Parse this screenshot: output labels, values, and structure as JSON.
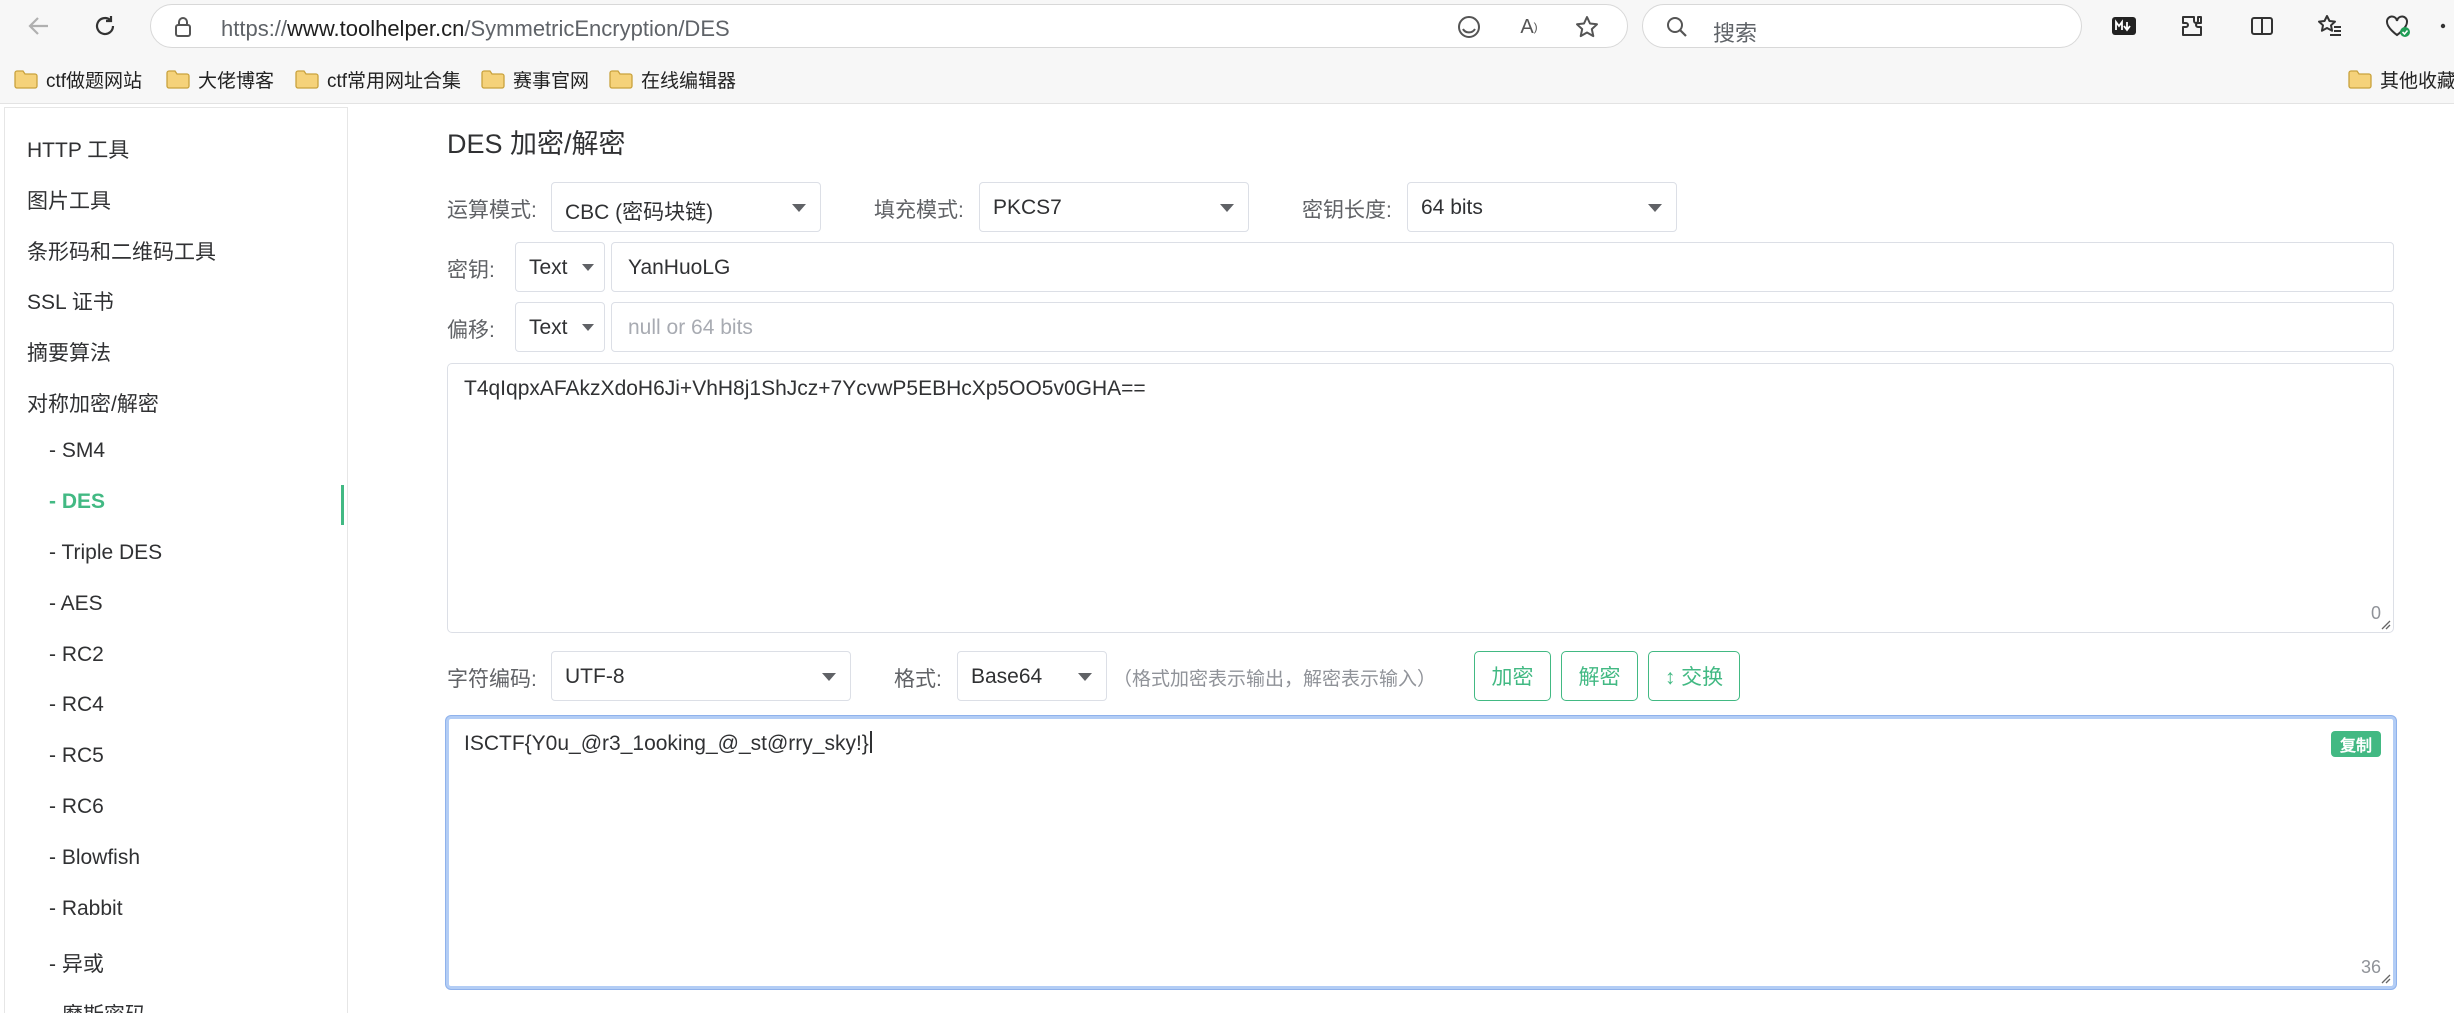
{
  "browser": {
    "url_prefix": "https://",
    "url_domain": "www.toolhelper.cn",
    "url_path": "/SymmetricEncryption/DES",
    "search_placeholder": "搜索",
    "bookmarks": [
      "ctf做题网站",
      "大佬博客",
      "ctf常用网址合集",
      "赛事官网",
      "在线编辑器"
    ],
    "other_bookmarks": "其他收藏"
  },
  "sidebar": {
    "categories": [
      "HTTP 工具",
      "图片工具",
      "条形码和二维码工具",
      "SSL 证书",
      "摘要算法",
      "对称加密/解密"
    ],
    "sub_items": [
      "- SM4",
      "- DES",
      "- Triple DES",
      "- AES",
      "- RC2",
      "- RC4",
      "- RC5",
      "- RC6",
      "- Blowfish",
      "- Rabbit",
      "- 异或",
      "- 摩斯密码"
    ],
    "active": "- DES"
  },
  "main": {
    "title": "DES 加密/解密",
    "mode_label": "运算模式:",
    "mode_value": "CBC (密码块链)",
    "padding_label": "填充模式:",
    "padding_value": "PKCS7",
    "keylen_label": "密钥长度:",
    "keylen_value": "64 bits",
    "key_label": "密钥:",
    "key_type": "Text",
    "key_value": "YanHuoLG",
    "iv_label": "偏移:",
    "iv_type": "Text",
    "iv_placeholder": "null or 64 bits",
    "input_text": "T4qIqpxAFAkzXdoH6Ji+VhH8j1ShJcz+7YcvwP5EBHcXp5OO5v0GHA==",
    "input_count": "0",
    "charset_label": "字符编码:",
    "charset_value": "UTF-8",
    "format_label": "格式:",
    "format_value": "Base64",
    "format_hint": "（格式加密表示输出，解密表示输入）",
    "encrypt_label": "加密",
    "decrypt_label": "解密",
    "swap_label": "↕ 交换",
    "output_text": "ISCTF{Y0u_@r3_1ooking_@_st@rry_sky!}",
    "output_count": "36",
    "copy_label": "复制"
  },
  "colors": {
    "accent": "#42b983",
    "text": "#303133",
    "muted": "#909399",
    "border": "#dcdfe6"
  }
}
